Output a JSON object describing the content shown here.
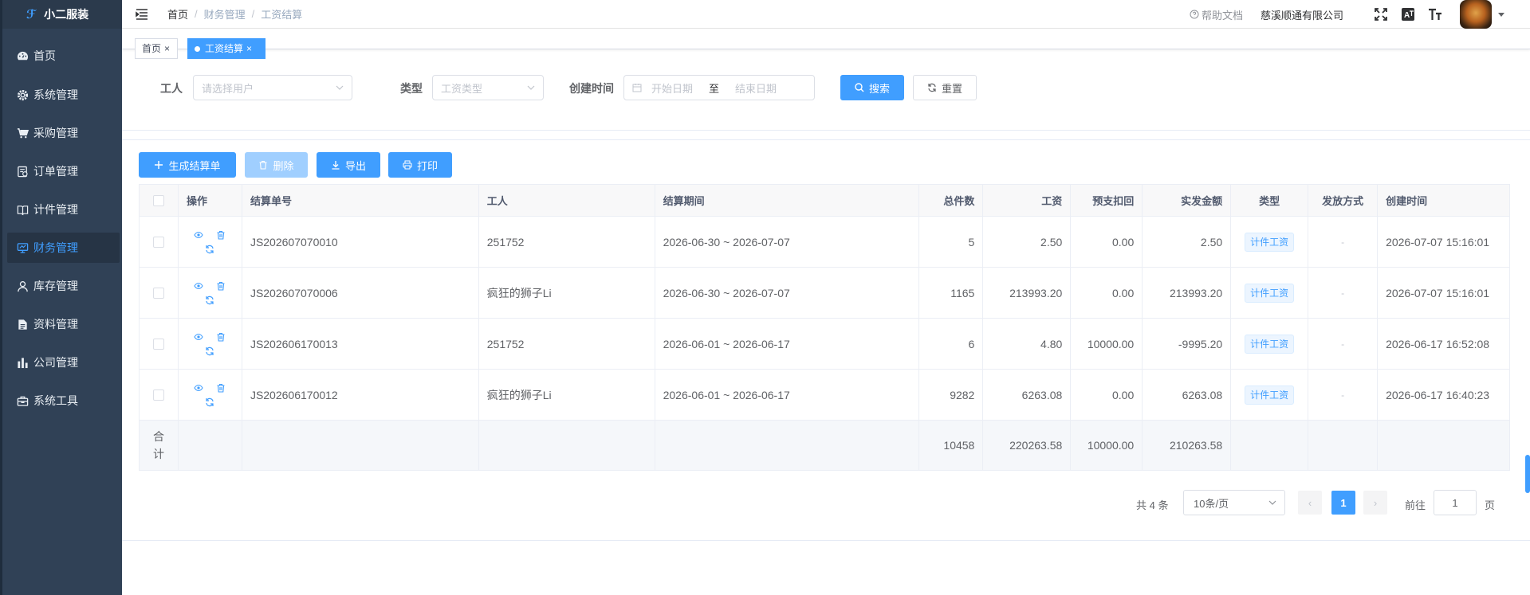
{
  "app": {
    "logo_text": "小二服装",
    "logo_mark": "ℱ"
  },
  "sidebar": {
    "items": [
      {
        "label": "首页",
        "icon": "dashboard-icon"
      },
      {
        "label": "系统管理",
        "icon": "gear-icon"
      },
      {
        "label": "采购管理",
        "icon": "cart-icon"
      },
      {
        "label": "订单管理",
        "icon": "order-icon"
      },
      {
        "label": "计件管理",
        "icon": "book-icon"
      },
      {
        "label": "财务管理",
        "icon": "finance-icon",
        "active": true
      },
      {
        "label": "库存管理",
        "icon": "user-icon"
      },
      {
        "label": "资料管理",
        "icon": "doc-icon"
      },
      {
        "label": "公司管理",
        "icon": "chart-icon"
      },
      {
        "label": "系统工具",
        "icon": "toolbox-icon"
      }
    ]
  },
  "header": {
    "breadcrumb": [
      "首页",
      "财务管理",
      "工资结算"
    ],
    "help": "帮助文档",
    "company": "慈溪顺通有限公司"
  },
  "tags": [
    {
      "label": "首页",
      "close": "×"
    },
    {
      "label": "工资结算",
      "close": "×",
      "active": true
    }
  ],
  "search": {
    "worker_label": "工人",
    "worker_placeholder": "请选择用户",
    "type_label": "类型",
    "type_placeholder": "工资类型",
    "created_label": "创建时间",
    "start_placeholder": "开始日期",
    "to": "至",
    "end_placeholder": "结束日期",
    "search_btn": "搜索",
    "reset_btn": "重置"
  },
  "toolbar": {
    "generate": "生成结算单",
    "delete": "删除",
    "export": "导出",
    "print": "打印"
  },
  "table": {
    "columns": [
      "操作",
      "结算单号",
      "工人",
      "结算期间",
      "总件数",
      "工资",
      "预支扣回",
      "实发金额",
      "类型",
      "发放方式",
      "创建时间"
    ],
    "rows": [
      {
        "no": "JS202607070010",
        "worker": "251752",
        "period": "2026-06-30 ~ 2026-07-07",
        "count": "5",
        "wage": "2.50",
        "advance": "0.00",
        "net": "2.50",
        "type": "计件工资",
        "method": "-",
        "created": "2026-07-07 15:16:01"
      },
      {
        "no": "JS202607070006",
        "worker": "疯狂的狮子Li",
        "period": "2026-06-30 ~ 2026-07-07",
        "count": "1165",
        "wage": "213993.20",
        "advance": "0.00",
        "net": "213993.20",
        "type": "计件工资",
        "method": "-",
        "created": "2026-07-07 15:16:01"
      },
      {
        "no": "JS202606170013",
        "worker": "251752",
        "period": "2026-06-01 ~ 2026-06-17",
        "count": "6",
        "wage": "4.80",
        "advance": "10000.00",
        "net": "-9995.20",
        "type": "计件工资",
        "method": "-",
        "created": "2026-06-17 16:52:08"
      },
      {
        "no": "JS202606170012",
        "worker": "疯狂的狮子Li",
        "period": "2026-06-01 ~ 2026-06-17",
        "count": "9282",
        "wage": "6263.08",
        "advance": "0.00",
        "net": "6263.08",
        "type": "计件工资",
        "method": "-",
        "created": "2026-06-17 16:40:23"
      }
    ],
    "footer": {
      "label_1": "合",
      "label_2": "计",
      "count": "10458",
      "wage": "220263.58",
      "advance": "10000.00",
      "net": "210263.58"
    }
  },
  "pagination": {
    "total": "共 4 条",
    "page_size": "10条/页",
    "current": "1",
    "goto": "前往",
    "goto_value": "1",
    "page": "页",
    "prev": "‹",
    "next": "›"
  },
  "colors": {
    "primary": "#409eff",
    "sidebar": "#304156"
  }
}
